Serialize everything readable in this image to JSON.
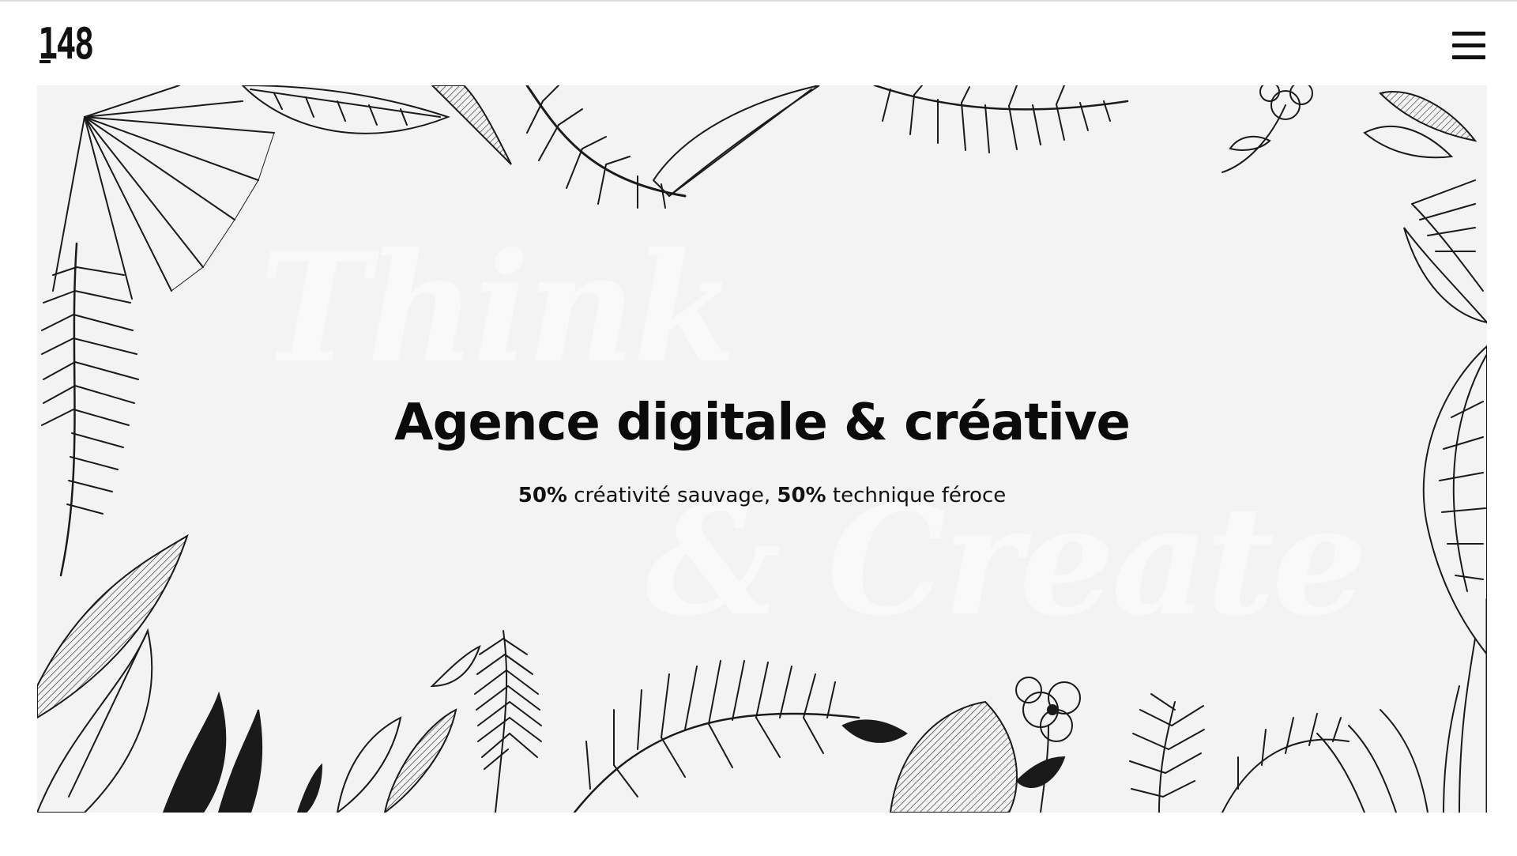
{
  "header": {
    "logo_text": "148",
    "menu_icon": "hamburger-menu-icon"
  },
  "hero": {
    "background_word_1": "Think",
    "background_word_2": "& Create",
    "headline": "Agence digitale & créative",
    "tagline": {
      "part1_bold": "50%",
      "part1_text": " créativité sauvage, ",
      "part2_bold": "50%",
      "part2_text": " technique féroce"
    },
    "illustration": "tropical-foliage-line-art"
  },
  "colors": {
    "text": "#0b0b0b",
    "hero_background": "#f3f3f3",
    "page_background": "#ffffff"
  }
}
